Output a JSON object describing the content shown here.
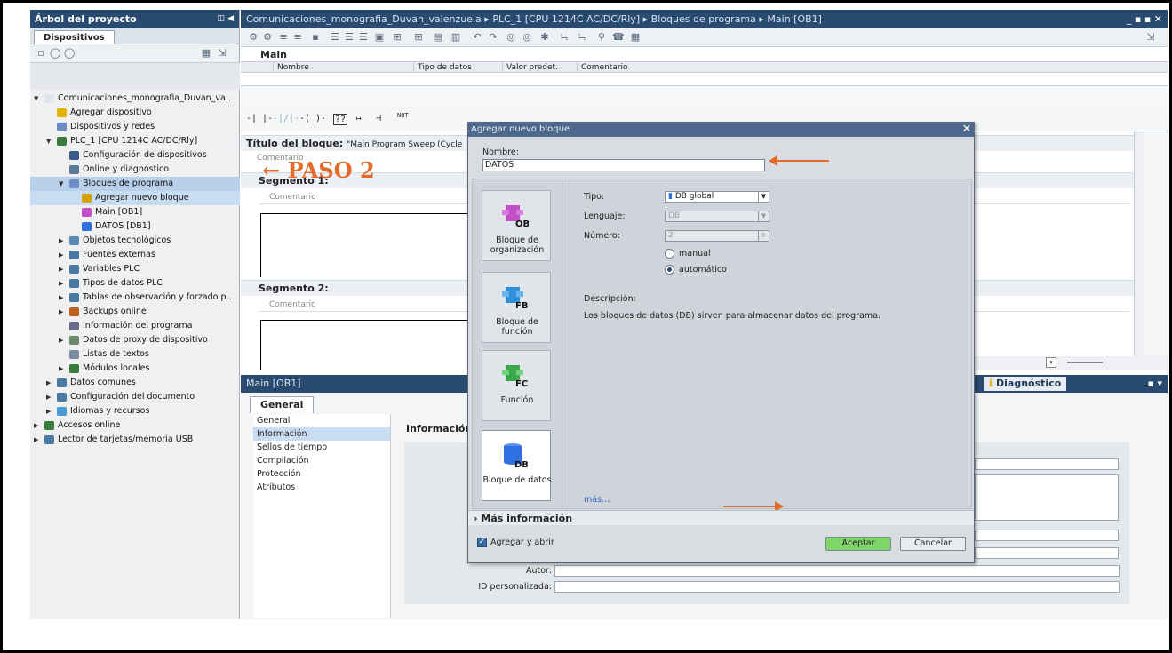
{
  "project_tree": {
    "title": "Árbol del proyecto",
    "tab": "Dispositivos",
    "items": [
      {
        "label": "Comunicaciones_monografia_Duvan_va.."
      },
      {
        "label": "Agregar dispositivo"
      },
      {
        "label": "Dispositivos y redes"
      },
      {
        "label": "PLC_1 [CPU 1214C AC/DC/Rly]"
      },
      {
        "label": "Configuración de dispositivos"
      },
      {
        "label": "Online y diagnóstico"
      },
      {
        "label": "Bloques de programa"
      },
      {
        "label": "Agregar nuevo bloque"
      },
      {
        "label": "Main [OB1]"
      },
      {
        "label": "DATOS [DB1]"
      },
      {
        "label": "Objetos tecnológicos"
      },
      {
        "label": "Fuentes externas"
      },
      {
        "label": "Variables PLC"
      },
      {
        "label": "Tipos de datos PLC"
      },
      {
        "label": "Tablas de observación y forzado p.."
      },
      {
        "label": "Backups online"
      },
      {
        "label": "Información del programa"
      },
      {
        "label": "Datos de proxy de dispositivo"
      },
      {
        "label": "Listas de textos"
      },
      {
        "label": "Módulos locales"
      },
      {
        "label": "Datos comunes"
      },
      {
        "label": "Configuración del documento"
      },
      {
        "label": "Idiomas y recursos"
      },
      {
        "label": "Accesos online"
      },
      {
        "label": "Lector de tarjetas/memoria USB"
      }
    ]
  },
  "main": {
    "breadcrumb": "Comunicaciones_monografia_Duvan_valenzuela  ▸  PLC_1 [CPU 1214C AC/DC/Rly]  ▸  Bloques de programa  ▸  Main [OB1]",
    "window_controls": "_ ▪ ▪ ✕",
    "block_name": "Main",
    "columns": [
      "Nombre",
      "Tipo de datos",
      "Valor predet.",
      "Comentario"
    ],
    "ladder_symbols": [
      "-| |-",
      "-|/|-",
      "-( )-",
      "??",
      "↦",
      "⊣",
      "NOT"
    ],
    "block_title_label": "Título del bloque:",
    "block_title_value": "\"Main Program Sweep (Cycle",
    "comment": "Comentario",
    "segment1": "Segmento 1:",
    "segment2": "Segmento 2:",
    "annotation_paso2": "PASO 2"
  },
  "inspector": {
    "title": "Main [OB1]",
    "tab_general": "General",
    "diag_tab": "Diagnóstico",
    "nav": [
      "General",
      "Información",
      "Sellos de tiempo",
      "Compilación",
      "Protección",
      "Atributos"
    ],
    "section": "Información",
    "autor_label": "Autor:",
    "id_label": "ID personalizada:"
  },
  "dialog": {
    "title": "Agregar nuevo bloque",
    "name_label": "Nombre:",
    "name_value": "DATOS",
    "blocks": [
      {
        "code": "OB",
        "label": "Bloque de organización",
        "color": "#c04fc8"
      },
      {
        "code": "FB",
        "label": "Bloque de función",
        "color": "#2f8fd8"
      },
      {
        "code": "FC",
        "label": "Función",
        "color": "#3aa84a"
      },
      {
        "code": "DB",
        "label": "Bloque de datos",
        "color": "#2f6fe0"
      }
    ],
    "tipo_label": "Tipo:",
    "tipo_value": "DB global",
    "lenguaje_label": "Lenguaje:",
    "lenguaje_value": "DB",
    "numero_label": "Número:",
    "numero_value": "2",
    "manual": "manual",
    "automatico": "automático",
    "descripcion_label": "Descripción:",
    "descripcion": "Los bloques de datos (DB) sirven para almacenar datos del programa.",
    "mas_link": "más...",
    "mas_info": "Más información",
    "agregar_abrir": "Agregar y abrir",
    "aceptar": "Aceptar",
    "cancelar": "Cancelar"
  },
  "colors": {
    "titlebar": "#2a4b70",
    "accent_arrow": "#e36c2a",
    "accept_btn": "#7fd46a"
  }
}
